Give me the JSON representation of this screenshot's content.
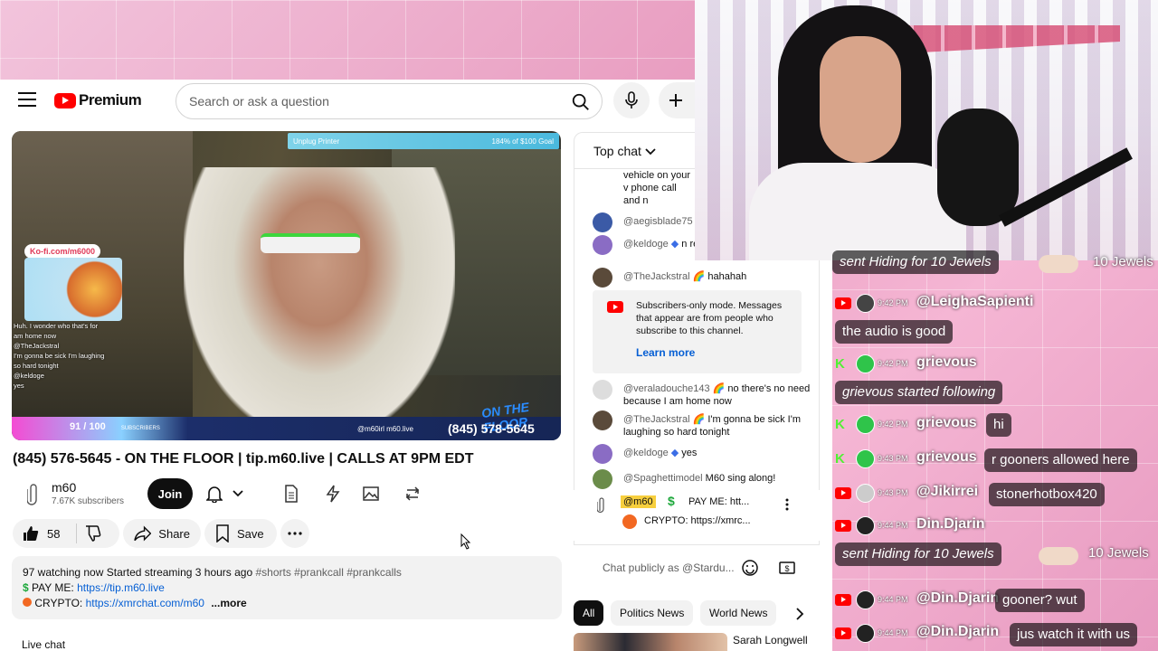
{
  "youtube": {
    "logo_text": "Premium",
    "search_placeholder": "Search or ask a question",
    "video": {
      "overlay_topbar_left": "Unplug Printer",
      "overlay_topbar_right": "184% of $100 Goal",
      "overlay_kofi": "Ko-fi.com/m6000",
      "overlay_chat": [
        "Huh. I wonder who that's for",
        "am home now",
        "@TheJackstral",
        "I'm gonna be sick I'm laughing",
        "so hard tonight",
        "@keldoge",
        "yes"
      ],
      "sub_counter": "91 / 100",
      "sub_counter_label": "SUBSCRIBERS",
      "overlay_handles": "@m60irl  m60.live",
      "overlay_phone": "(845) 578-5645",
      "overlay_on_the_floor": "ON THE FLOOR"
    },
    "title": "(845) 576-5645 - ON THE FLOOR | tip.m60.live | CALLS AT 9PM EDT",
    "channel": {
      "name": "m60",
      "subscribers": "7.67K subscribers",
      "join_label": "Join"
    },
    "actions": {
      "like_count": "58",
      "share_label": "Share",
      "save_label": "Save"
    },
    "description": {
      "stats": "97 watching now  Started streaming 3 hours ago",
      "tags": "#shorts #prankcall #prankcalls",
      "pay_label": "PAY ME:",
      "pay_link": "https://tip.m60.live",
      "crypto_label": "CRYPTO:",
      "crypto_link": "https://xmrchat.com/m60",
      "more": "...more"
    },
    "live_chat_label": "Live chat"
  },
  "chat": {
    "mode": "Top chat",
    "messages": [
      {
        "author": "",
        "text": "vehicle on your v phone call and n passengers mai"
      },
      {
        "author": "@aegisblade75",
        "text": ""
      },
      {
        "author": "@keldoge",
        "text": "n remix"
      },
      {
        "author": "@TheJackstral",
        "text": "hahahah"
      },
      {
        "author": "@veraladouche143",
        "text": "no there's no need because I am home now"
      },
      {
        "author": "@TheJackstral",
        "text": "I'm gonna be sick I'm laughing so hard tonight"
      },
      {
        "author": "@keldoge",
        "text": "yes"
      },
      {
        "author": "@Spaghettimodel",
        "text": "M60 sing along!"
      }
    ],
    "notice": {
      "text": "Subscribers-only mode. Messages that appear are from people who subscribe to this channel.",
      "learn_more": "Learn more"
    },
    "pinned": {
      "author": "@m60",
      "line1": "PAY ME: htt...",
      "line2": "CRYPTO: https://xmrc..."
    },
    "input_placeholder": "Chat publicly as @Stardu..."
  },
  "chips": [
    "All",
    "Politics News",
    "World News"
  ],
  "related": {
    "channel": "Sarah Longwell"
  },
  "stream_chat": [
    {
      "platform": "youtube",
      "time": "",
      "user": "sent Hiding for 10 Jewels",
      "message": "",
      "jewels": "10 Jewels",
      "event": true
    },
    {
      "platform": "youtube",
      "time": "9:42 PM",
      "user": "@LeighaSapienti",
      "message": "the audio is good"
    },
    {
      "platform": "kick",
      "time": "9:42 PM",
      "user": "grievous",
      "message": "grievous started following",
      "event_follow": true
    },
    {
      "platform": "kick",
      "time": "9:42 PM",
      "user": "grievous",
      "message": "hi"
    },
    {
      "platform": "kick",
      "time": "9:43 PM",
      "user": "grievous",
      "message": "r gooners allowed here"
    },
    {
      "platform": "youtube",
      "time": "9:43 PM",
      "user": "@Jikirrei",
      "message": "stonerhotbox420"
    },
    {
      "platform": "youtube",
      "time": "9:44 PM",
      "user": "Din.Djarin",
      "message": ""
    },
    {
      "platform": "youtube",
      "time": "",
      "user": "sent Hiding for 10 Jewels",
      "message": "",
      "jewels": "10 Jewels",
      "event": true
    },
    {
      "platform": "youtube",
      "time": "9:44 PM",
      "user": "@Din.Djarin",
      "message": "gooner? wut"
    },
    {
      "platform": "youtube",
      "time": "9:44 PM",
      "user": "@Din.Djarin",
      "message": "jus watch it with us"
    }
  ],
  "colors": {
    "youtube_red": "#ff0000",
    "kick_green": "#52f035",
    "link_blue": "#065fd4"
  }
}
